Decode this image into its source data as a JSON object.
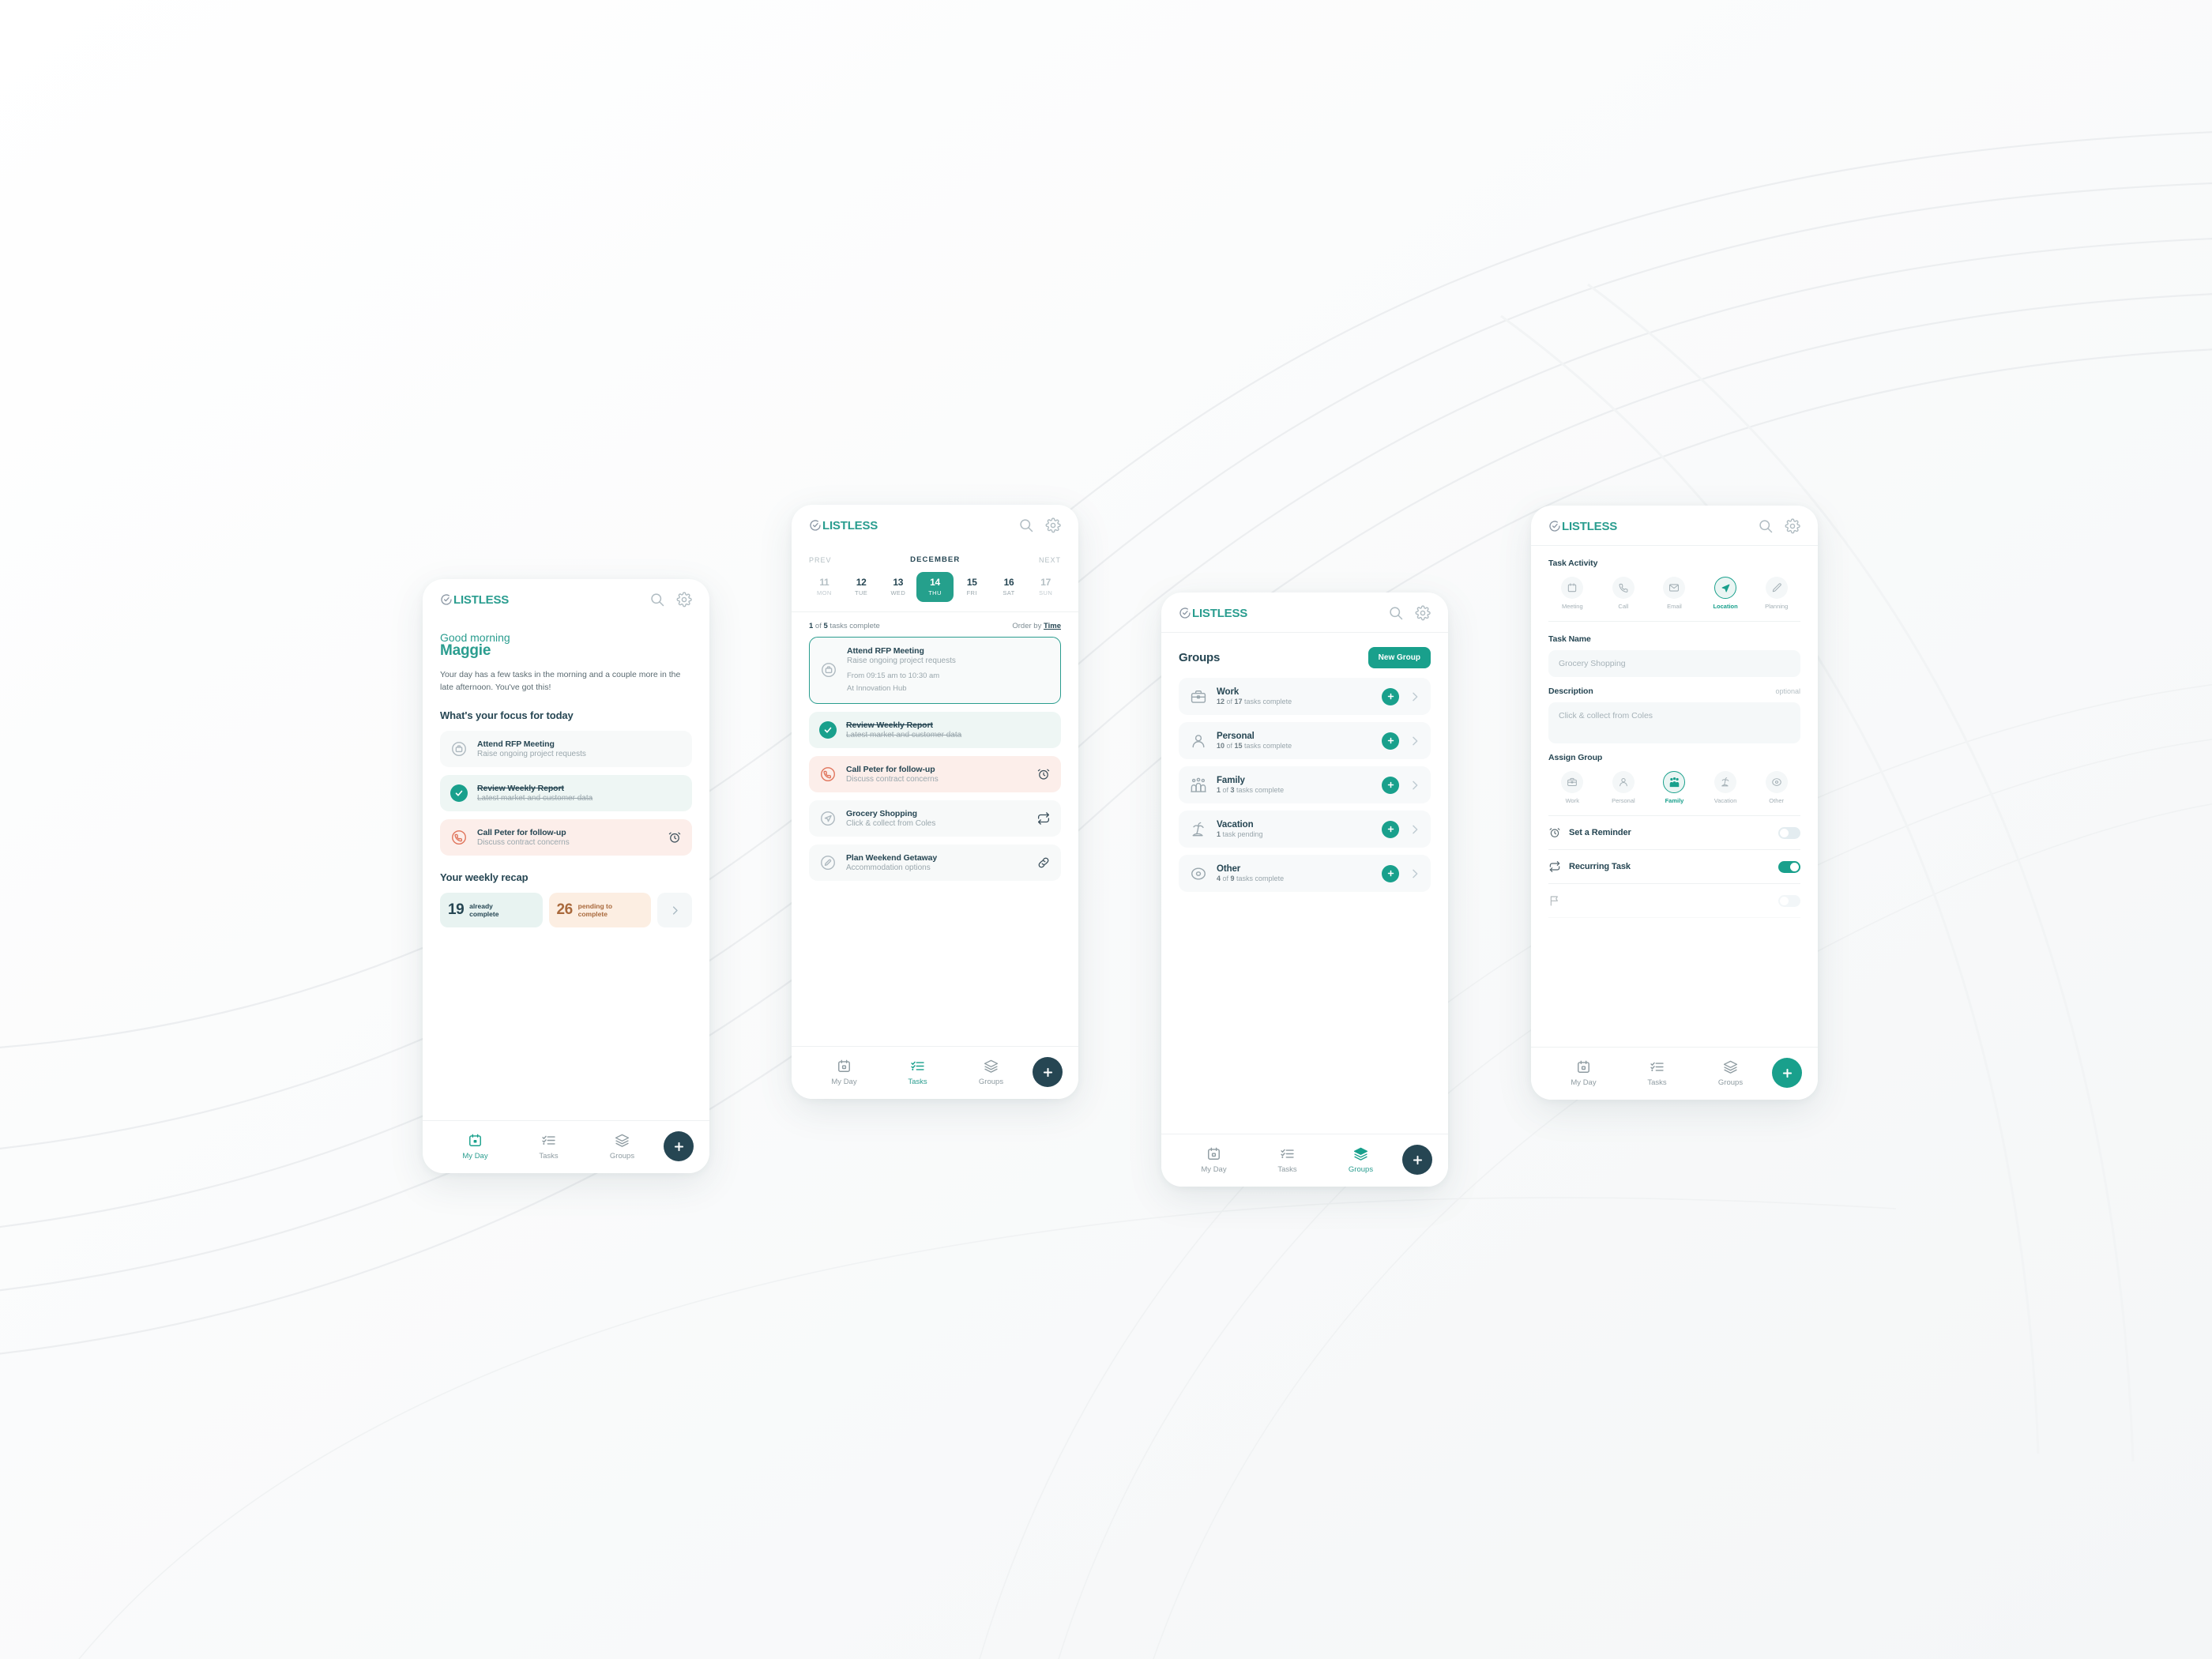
{
  "brand": {
    "name": "LISTLESS",
    "logo_icon": "circle-check-icon",
    "teal": "#2a9d8f",
    "navy": "#264653",
    "green_accent": "#19a08c",
    "peach": "#fceee2",
    "alert_bg": "#fceeea"
  },
  "appbar": {
    "search_icon": "search-icon",
    "settings_icon": "gear-icon"
  },
  "bottom_nav": {
    "items": [
      {
        "label": "My Day",
        "icon": "calendar-icon"
      },
      {
        "label": "Tasks",
        "icon": "checklist-icon"
      },
      {
        "label": "Groups",
        "icon": "layers-icon"
      }
    ],
    "fab_icon": "plus-icon"
  },
  "phone1": {
    "greeting_line1": "Good morning",
    "greeting_name": "Maggie",
    "blurb": "Your day has a few tasks in the morning and a couple more in the late afternoon. You've got this!",
    "focus_heading": "What's your focus for today",
    "focus_tasks": [
      {
        "title": "Attend RFP Meeting",
        "subtitle": "Raise ongoing project requests",
        "icon": "briefcase-circle-icon",
        "state": "default",
        "trailing_icon": ""
      },
      {
        "title": "Review Weekly Report",
        "subtitle": "Latest market and customer data",
        "icon": "check-circle-icon",
        "state": "done",
        "trailing_icon": ""
      },
      {
        "title": "Call Peter for follow-up",
        "subtitle": "Discuss contract concerns",
        "icon": "phone-circle-icon",
        "state": "alert",
        "trailing_icon": "alarm-icon"
      }
    ],
    "recap_heading": "Your weekly recap",
    "recap_stats": [
      {
        "number": "19",
        "label_line1": "already",
        "label_line2": "complete",
        "tone": "green"
      },
      {
        "number": "26",
        "label_line1": "pending to",
        "label_line2": "complete",
        "tone": "peach"
      }
    ],
    "recap_more_icon": "chevron-right-icon",
    "active_nav": "My Day"
  },
  "phone2": {
    "calendar": {
      "prev_label": "PREV",
      "month_label": "DECEMBER",
      "next_label": "NEXT",
      "days": [
        {
          "num": "11",
          "wd": "MON",
          "state": "dim"
        },
        {
          "num": "12",
          "wd": "TUE",
          "state": "strong"
        },
        {
          "num": "13",
          "wd": "WED",
          "state": "strong"
        },
        {
          "num": "14",
          "wd": "THU",
          "state": "selected"
        },
        {
          "num": "15",
          "wd": "FRI",
          "state": "strong"
        },
        {
          "num": "16",
          "wd": "SAT",
          "state": "strong"
        },
        {
          "num": "17",
          "wd": "SUN",
          "state": "dim"
        }
      ]
    },
    "progress_prefix": "1",
    "progress_mid": " of ",
    "progress_total": "5",
    "progress_suffix": " tasks complete",
    "order_by_label": "Order by ",
    "order_by_value": "Time",
    "tasks": [
      {
        "title": "Attend RFP Meeting",
        "subtitle": "Raise ongoing project requests",
        "meta_line1": "From 09:15 am to 10:30 am",
        "meta_line2": "At Innovation Hub",
        "icon": "briefcase-circle-icon",
        "state": "outlined",
        "trailing_icon": ""
      },
      {
        "title": "Review Weekly Report",
        "subtitle": "Latest market and customer data",
        "icon": "check-circle-icon",
        "state": "done",
        "trailing_icon": ""
      },
      {
        "title": "Call Peter for follow-up",
        "subtitle": "Discuss contract concerns",
        "icon": "phone-circle-icon",
        "state": "alert",
        "trailing_icon": "alarm-icon"
      },
      {
        "title": "Grocery Shopping",
        "subtitle": "Click & collect from Coles",
        "icon": "location-circle-icon",
        "state": "default",
        "trailing_icon": "repeat-icon"
      },
      {
        "title": "Plan Weekend Getaway",
        "subtitle": "Accommodation options",
        "icon": "pencil-circle-icon",
        "state": "default",
        "trailing_icon": "link-icon"
      }
    ],
    "active_nav": "Tasks"
  },
  "phone3": {
    "title": "Groups",
    "new_group_label": "New Group",
    "groups": [
      {
        "name": "Work",
        "count_prefix": "12",
        "count_mid": " of ",
        "count_total": "17",
        "count_suffix": " tasks complete",
        "icon": "briefcase-icon"
      },
      {
        "name": "Personal",
        "count_prefix": "10",
        "count_mid": " of ",
        "count_total": "15",
        "count_suffix": " tasks complete",
        "icon": "person-icon"
      },
      {
        "name": "Family",
        "count_prefix": "1",
        "count_mid": " of ",
        "count_total": "3",
        "count_suffix": " tasks complete",
        "icon": "family-icon"
      },
      {
        "name": "Vacation",
        "count_prefix": "1",
        "count_mid": "",
        "count_total": "",
        "count_suffix": " task pending",
        "icon": "palm-icon"
      },
      {
        "name": "Other",
        "count_prefix": "4",
        "count_mid": " of ",
        "count_total": "9",
        "count_suffix": " tasks complete",
        "icon": "target-icon"
      }
    ],
    "add_icon": "plus-icon",
    "chevron_icon": "chevron-right-icon",
    "active_nav": "Groups"
  },
  "phone4": {
    "activity_label": "Task Activity",
    "activities": [
      {
        "label": "Meeting",
        "icon": "calendar-icon",
        "active": false
      },
      {
        "label": "Call",
        "icon": "phone-icon",
        "active": false
      },
      {
        "label": "Email",
        "icon": "envelope-icon",
        "active": false
      },
      {
        "label": "Location",
        "icon": "navigate-icon",
        "active": true
      },
      {
        "label": "Planning",
        "icon": "pencil-icon",
        "active": false
      }
    ],
    "task_name_label": "Task Name",
    "task_name_value": "Grocery Shopping",
    "description_label": "Description",
    "description_optional": "optional",
    "description_value": "Click & collect from Coles",
    "assign_group_label": "Assign Group",
    "groups": [
      {
        "label": "Work",
        "icon": "briefcase-icon",
        "active": false
      },
      {
        "label": "Personal",
        "icon": "person-icon",
        "active": false
      },
      {
        "label": "Family",
        "icon": "family-icon",
        "active": true
      },
      {
        "label": "Vacation",
        "icon": "palm-icon",
        "active": false
      },
      {
        "label": "Other",
        "icon": "target-icon",
        "active": false
      }
    ],
    "toggles": [
      {
        "label": "Set a Reminder",
        "icon": "alarm-icon",
        "on": false
      },
      {
        "label": "Recurring Task",
        "icon": "repeat-icon",
        "on": true
      }
    ],
    "active_nav": ""
  }
}
